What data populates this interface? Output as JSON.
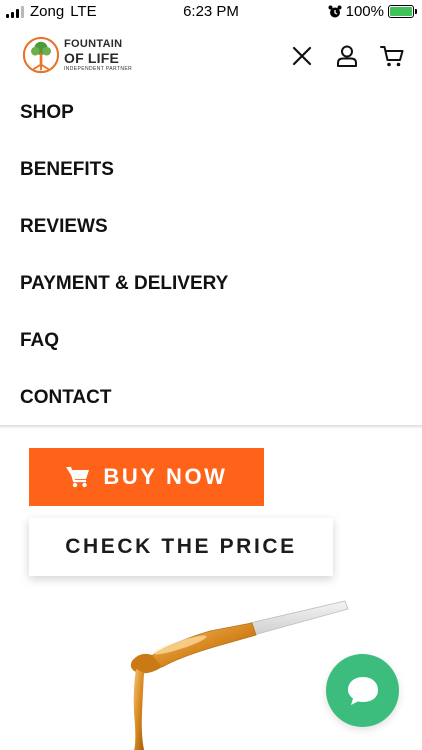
{
  "status_bar": {
    "carrier": "Zong",
    "network": "LTE",
    "time": "6:23 PM",
    "battery": "100%",
    "battery_level": 1.0
  },
  "header": {
    "logo": {
      "line1": "FOUNTAIN",
      "line2": "OF LIFE",
      "line3": "INDEPENDENT PARTNER"
    },
    "icons": [
      "close-icon",
      "user-icon",
      "cart-icon"
    ]
  },
  "menu": {
    "items": [
      {
        "label": "SHOP"
      },
      {
        "label": "BENEFITS"
      },
      {
        "label": "REVIEWS"
      },
      {
        "label": "PAYMENT & DELIVERY"
      },
      {
        "label": "FAQ"
      },
      {
        "label": "CONTACT"
      }
    ]
  },
  "cta": {
    "buy_label": "BUY NOW",
    "check_label": "CHECK THE PRICE"
  },
  "colors": {
    "accent": "#ff6319",
    "chat": "#3dbd7d",
    "battery": "#3fc25a",
    "logo_orange": "#e8742a",
    "logo_green": "#4e9a3a"
  }
}
